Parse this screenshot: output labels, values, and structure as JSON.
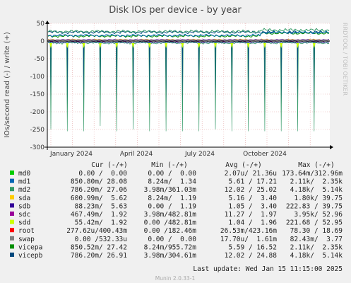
{
  "chart_data": {
    "type": "line",
    "title": "Disk IOs per device - by year",
    "ylabel": "IOs/second read (-) / write (+)",
    "side_label": "RRDTOOL / TOBI OETIKER",
    "ylim": [
      -300,
      50
    ],
    "y_ticks": [
      -300,
      -250,
      -200,
      -150,
      -100,
      -50,
      0,
      50
    ],
    "x_tick_labels": [
      "January 2024",
      "April 2024",
      "July 2024",
      "October 2024"
    ],
    "grid": true,
    "series": [
      {
        "name": "md0",
        "color": "#00cc00"
      },
      {
        "name": "md1",
        "color": "#0066b3"
      },
      {
        "name": "md2",
        "color": "#339966"
      },
      {
        "name": "sda",
        "color": "#ffcc00"
      },
      {
        "name": "sdb",
        "color": "#330099"
      },
      {
        "name": "sdc",
        "color": "#990099"
      },
      {
        "name": "sdd",
        "color": "#ccff00"
      },
      {
        "name": "root",
        "color": "#ff0000"
      },
      {
        "name": "swap",
        "color": "#808080"
      },
      {
        "name": "vicepa",
        "color": "#008f00"
      },
      {
        "name": "vicepb",
        "color": "#00487d"
      }
    ],
    "read_spike_depths": [
      -250,
      -255,
      -255,
      -240,
      -255,
      -250,
      -255,
      -255,
      -255,
      -255,
      -250,
      -255,
      -255,
      -255,
      -255,
      -255,
      -255
    ]
  },
  "legend": {
    "headers": {
      "cur": "Cur (-/+)",
      "min": "Min (-/+)",
      "avg": "Avg (-/+)",
      "max": "Max (-/+)"
    },
    "rows": [
      {
        "name": "md0",
        "color": "#00cc00",
        "cur": "0.00 /  0.00",
        "min": "0.00 /  0.00",
        "avg": "2.07u/ 21.36u",
        "max": "173.64m/312.96m"
      },
      {
        "name": "md1",
        "color": "#0066b3",
        "cur": "850.80m/ 28.08",
        "min": "8.24m/  1.34",
        "avg": "5.61 / 17.21",
        "max": "2.11k/  2.35k"
      },
      {
        "name": "md2",
        "color": "#339966",
        "cur": "786.20m/ 27.06",
        "min": "3.98m/361.03m",
        "avg": "12.02 / 25.02",
        "max": "4.18k/  5.14k"
      },
      {
        "name": "sda",
        "color": "#ffcc00",
        "cur": "600.99m/  5.62",
        "min": "8.24m/  1.19",
        "avg": "5.16 /  3.40",
        "max": "1.80k/ 39.75"
      },
      {
        "name": "sdb",
        "color": "#330099",
        "cur": "88.23m/  5.63",
        "min": "0.00 /  1.19",
        "avg": "1.05 /  3.40",
        "max": "222.83 / 39.75"
      },
      {
        "name": "sdc",
        "color": "#990099",
        "cur": "467.49m/  1.92",
        "min": "3.98m/482.81m",
        "avg": "11.27 /  1.97",
        "max": "3.95k/ 52.96"
      },
      {
        "name": "sdd",
        "color": "#ccff00",
        "cur": "55.42m/  1.92",
        "min": "0.00 /482.81m",
        "avg": "1.04 /  1.96",
        "max": "221.68 / 52.95"
      },
      {
        "name": "root",
        "color": "#ff0000",
        "cur": "277.62u/400.43m",
        "min": "0.00 /182.46m",
        "avg": "26.53m/423.16m",
        "max": "78.30 / 18.69"
      },
      {
        "name": "swap",
        "color": "#808080",
        "cur": "0.00 /532.33u",
        "min": "0.00 /  0.00",
        "avg": "17.70u/  1.61m",
        "max": "82.43m/  3.77"
      },
      {
        "name": "vicepa",
        "color": "#008f00",
        "cur": "850.52m/ 27.42",
        "min": "8.24m/955.72m",
        "avg": "5.59 / 16.52",
        "max": "2.11k/  2.35k"
      },
      {
        "name": "vicepb",
        "color": "#00487d",
        "cur": "786.20m/ 26.91",
        "min": "3.98m/304.61m",
        "avg": "12.02 / 24.88",
        "max": "4.18k/  5.14k"
      }
    ]
  },
  "footer": {
    "last_update": "Last update:  Wed Jan 15 11:15:00 2025",
    "munin_version": "Munin 2.0.33-1"
  }
}
